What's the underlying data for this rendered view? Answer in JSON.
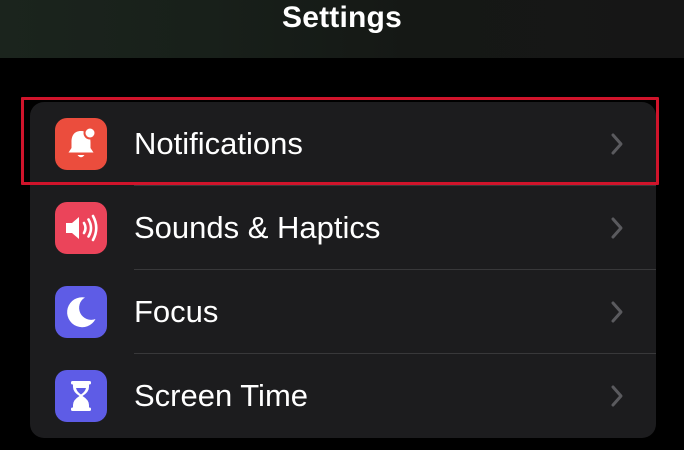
{
  "header": {
    "title": "Settings"
  },
  "settings_group": {
    "items": [
      {
        "label": "Notifications",
        "icon": "bell-badge-icon",
        "icon_color": "#eb4d3d",
        "highlighted": true
      },
      {
        "label": "Sounds & Haptics",
        "icon": "speaker-wave-icon",
        "icon_color": "#eb445a"
      },
      {
        "label": "Focus",
        "icon": "moon-icon",
        "icon_color": "#5e5ce6"
      },
      {
        "label": "Screen Time",
        "icon": "hourglass-icon",
        "icon_color": "#5e5ce6"
      }
    ]
  },
  "colors": {
    "background": "#000000",
    "group_background": "#1c1c1e",
    "text": "#ffffff",
    "chevron": "#5a5a5e",
    "separator": "#38383a",
    "highlight_border": "#d0142b"
  }
}
